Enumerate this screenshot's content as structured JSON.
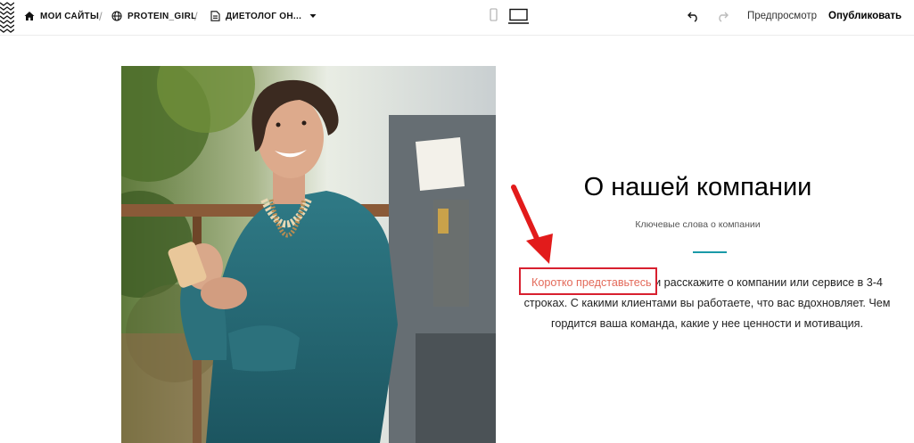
{
  "toolbar": {
    "my_sites_label": "МОИ САЙТЫ",
    "site_name": "PROTEIN_GIRL",
    "page_name": "ДИЕТОЛОГ ОН...",
    "preview_label": "Предпросмотр",
    "publish_label": "Опубликовать"
  },
  "section": {
    "title": "О нашей компании",
    "subtitle": "Ключевые слова о компании",
    "body_highlight": "Коротко представьтесь",
    "body_rest": " и расскажите о компании или сервисе в 3-4 строках. С какими клиентами вы работаете, что вас вдохновляет. Чем гордится ваша команда, какие у нее ценности и мотивация."
  },
  "colors": {
    "accent": "#1a9aa8",
    "link": "#e36a5a",
    "annotation": "#d8202f"
  },
  "icons": [
    "home-icon",
    "globe-icon",
    "page-icon",
    "chevron-down-icon",
    "mobile-icon",
    "desktop-icon",
    "undo-icon",
    "redo-icon"
  ]
}
